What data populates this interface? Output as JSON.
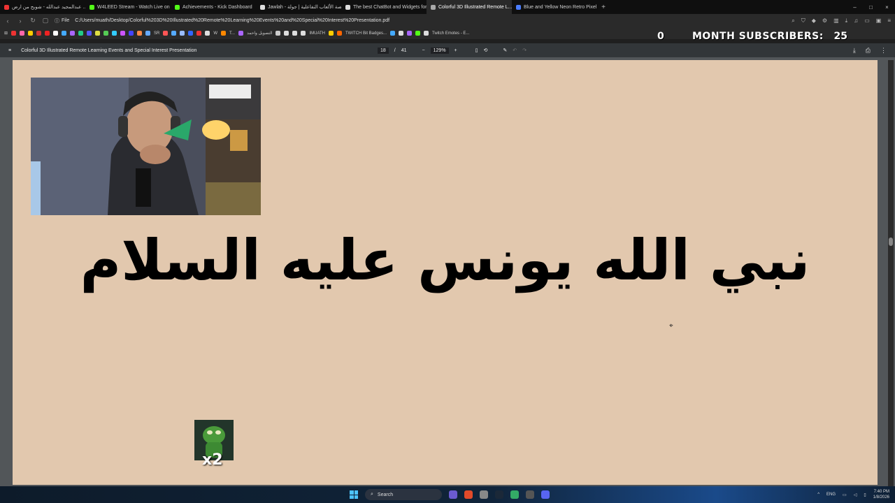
{
  "tabs": [
    {
      "label": "عبدالمجيد عبدالله - شويح من ارض ...",
      "icon_color": "#e33"
    },
    {
      "label": "W4LEED Stream - Watch Live on ...",
      "icon_color": "#53fc18"
    },
    {
      "label": "Achievements - Kick Dashboard",
      "icon_color": "#53fc18"
    },
    {
      "label": "Jawlah - منصة الألعاب التفاعلية | جولة",
      "icon_color": "#ddd"
    },
    {
      "label": "The best ChatBot and Widgets for K...",
      "icon_color": "#ddd"
    },
    {
      "label": "Colorful 3D Illustrated Remote L...",
      "icon_color": "#aaa",
      "active": true
    },
    {
      "label": "Blue and Yellow Neon Retro Pixel Art...",
      "icon_color": "#4a7dff"
    }
  ],
  "window_controls": {
    "minimize": "–",
    "maximize": "□",
    "close": "×"
  },
  "address": {
    "file_label": "File",
    "url": "C:/Users/muath/Desktop/Colorful%203D%20Illustrated%20Remote%20Learning%20Events%20and%20Special%20Interest%20Presentation.pdf"
  },
  "bookmarks": [
    {
      "label": "",
      "color": "#e33"
    },
    {
      "label": "",
      "color": "#f6a"
    },
    {
      "label": "",
      "color": "#fc0"
    },
    {
      "label": "",
      "color": "#c33"
    },
    {
      "label": "",
      "color": "#e22"
    },
    {
      "label": "",
      "color": "#fff"
    },
    {
      "label": "",
      "color": "#4af"
    },
    {
      "label": "",
      "color": "#a6f"
    },
    {
      "label": "",
      "color": "#2c8"
    },
    {
      "label": "",
      "color": "#55f"
    },
    {
      "label": "",
      "color": "#dd4"
    },
    {
      "label": "",
      "color": "#5c5"
    },
    {
      "label": "",
      "color": "#3cf"
    },
    {
      "label": "",
      "color": "#c5f"
    },
    {
      "label": "",
      "color": "#44f"
    },
    {
      "label": "",
      "color": "#f84"
    },
    {
      "label": "SR",
      "color": "#6af"
    },
    {
      "label": "",
      "color": "#f55"
    },
    {
      "label": "",
      "color": "#5af"
    },
    {
      "label": "",
      "color": "#9bf"
    },
    {
      "label": "",
      "color": "#36f"
    },
    {
      "label": "",
      "color": "#e33"
    },
    {
      "label": "W",
      "color": "#ddd"
    },
    {
      "label": "T...",
      "color": "#f80"
    },
    {
      "label": "التصويل واحمد",
      "color": "#a6f"
    },
    {
      "label": "",
      "color": "#ccc"
    },
    {
      "label": "",
      "color": "#ddd"
    },
    {
      "label": "",
      "color": "#ddd"
    },
    {
      "label": "IMUATH",
      "color": "#ddd"
    },
    {
      "label": "",
      "color": "#fc0"
    },
    {
      "label": "TWITCH Bit Badges...",
      "color": "#f60"
    },
    {
      "label": "",
      "color": "#4af"
    },
    {
      "label": "",
      "color": "#ddd"
    },
    {
      "label": "",
      "color": "#a6f"
    },
    {
      "label": "",
      "color": "#53fc18"
    },
    {
      "label": "Twitch Emotes - E...",
      "color": "#ddd"
    }
  ],
  "overlay": {
    "month_left": "0",
    "label": "MONTH SUBSCRIBERS:",
    "count": "25"
  },
  "pdf_toolbar": {
    "menu_icon": "≡",
    "title": "Colorful 3D Illustrated Remote Learning Events and Special Interest Presentation",
    "page_current": "18",
    "page_sep": "/",
    "page_total": "41",
    "zoom_out": "−",
    "zoom": "129%",
    "zoom_in": "+",
    "download_icon": "⤓",
    "print_icon": "⎙",
    "more_icon": "⋮"
  },
  "slide": {
    "heading": "نبي الله يونس عليه السلام",
    "emote_multiplier": "x2"
  },
  "taskbar": {
    "search_label": "Search",
    "lang": "ENG",
    "time": "7:40 PM",
    "date": "1/8/2026"
  }
}
